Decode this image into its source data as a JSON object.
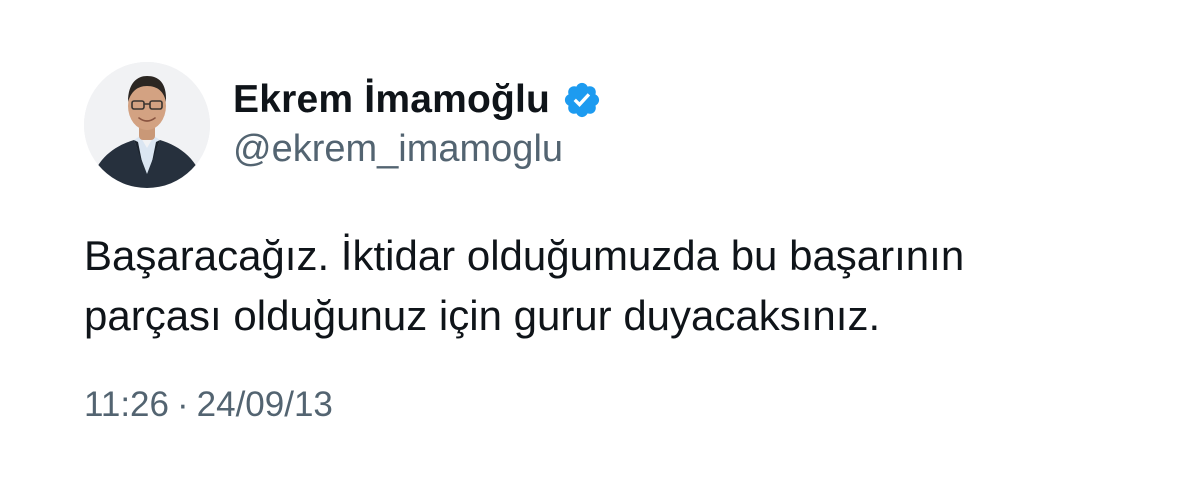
{
  "author": {
    "display_name": "Ekrem İmamoğlu",
    "handle": "@ekrem_imamoglu",
    "verified_icon": "verified-badge-icon",
    "verified_color": "#1d9bf0"
  },
  "tweet": {
    "lines": [
      "Başaracağız. İktidar olduğumuzda bu başarının",
      "parçası olduğunuz için gurur duyacaksınız."
    ]
  },
  "meta": {
    "time": "11:26",
    "separator": "·",
    "date": "24/09/13"
  },
  "colors": {
    "text_primary": "#0f1419",
    "text_secondary": "#536471",
    "background": "#ffffff"
  }
}
